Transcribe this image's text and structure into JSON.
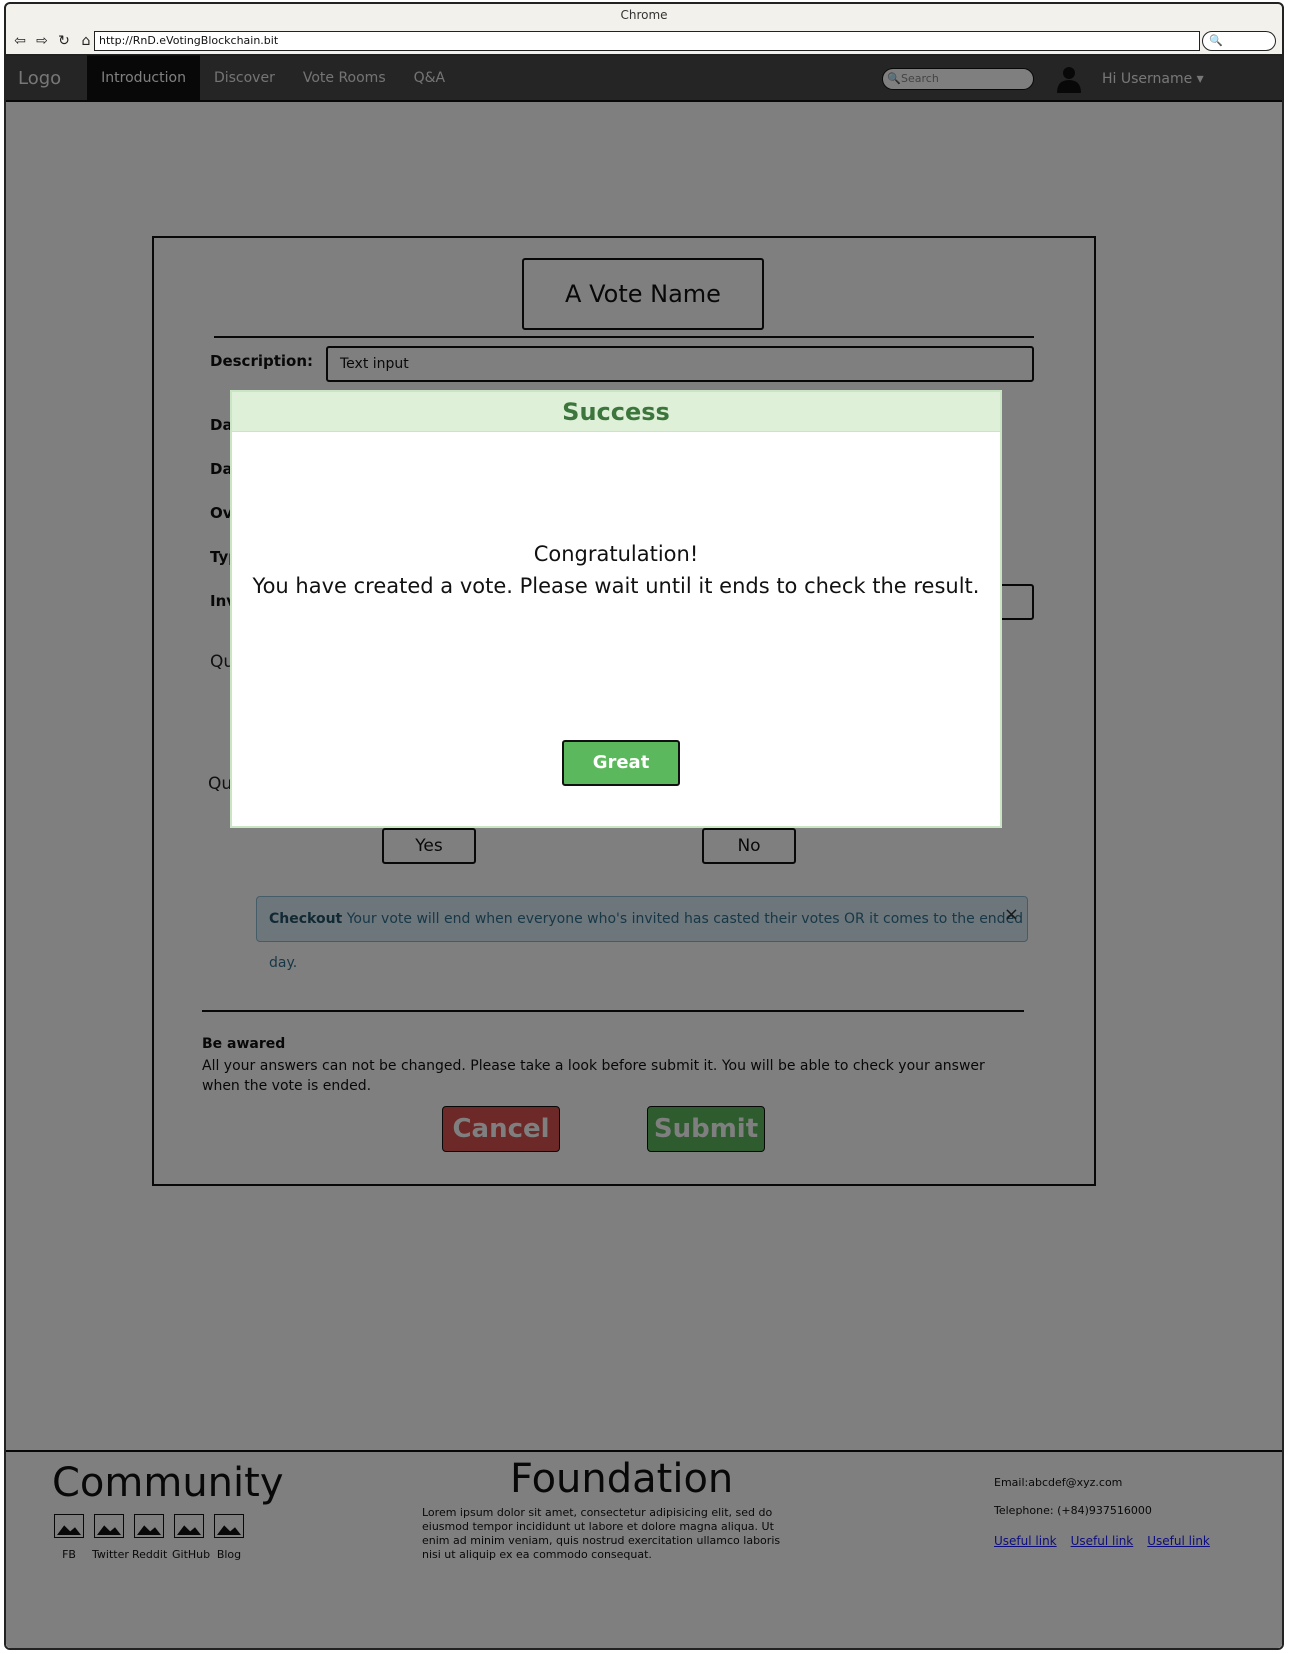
{
  "browser": {
    "title": "Chrome",
    "url": "http://RnD.eVotingBlockchain.bit"
  },
  "nav": {
    "logo": "Logo",
    "items": [
      {
        "label": "Introduction",
        "active": true
      },
      {
        "label": "Discover"
      },
      {
        "label": "Vote Rooms"
      },
      {
        "label": "Q&A"
      }
    ],
    "search_placeholder": "Search",
    "username": "Hi Username ▾"
  },
  "form": {
    "vote_name": "A Vote Name",
    "description_label": "Description:",
    "description_value": "Text input",
    "labels": [
      "Da",
      "Da",
      "Ov",
      "Typ",
      "Inv"
    ],
    "question_labels": [
      "Qu",
      "Qu"
    ],
    "yes": "Yes",
    "no": "No",
    "alert": {
      "strong": "Checkout",
      "text": " Your vote will end when everyone who's invited has casted their votes OR it comes to the ended day."
    },
    "awared_title": "Be awared",
    "awared_body": "All your answers can not be changed. Please take a look before submit it. You will be able to check your answer when the vote is ended.",
    "cancel": "Cancel",
    "submit": "Submit"
  },
  "footer": {
    "community": "Community",
    "social": [
      "FB",
      "Twitter",
      "Reddit",
      "GitHub",
      "Blog"
    ],
    "foundation": "Foundation",
    "lorem": "Lorem ipsum dolor sit amet, consectetur adipisicing elit, sed do eiusmod tempor incididunt ut labore et dolore magna aliqua. Ut enim ad minim veniam, quis nostrud exercitation ullamco laboris nisi ut aliquip ex ea commodo consequat.",
    "email": "Email:abcdef@xyz.com",
    "telephone": "Telephone: (+84)937516000",
    "links": [
      "Useful link",
      "Useful link",
      "Useful link"
    ]
  },
  "modal": {
    "title": "Success",
    "line1": "Congratulation!",
    "line2": "You have created a vote. Please wait until it ends to check the result.",
    "button": "Great"
  },
  "colors": {
    "success_header": "#dff0d8",
    "success_text": "#3c763d",
    "button_green": "#5cb85c",
    "button_red": "#d9534f",
    "alert_bg": "#d9edf7"
  }
}
